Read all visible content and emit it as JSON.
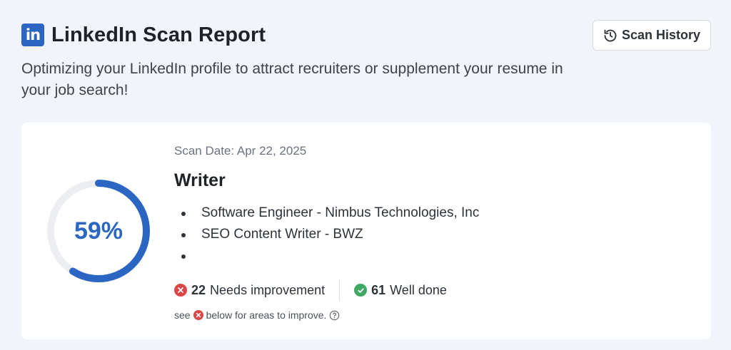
{
  "header": {
    "logo_text": "in",
    "title": "LinkedIn Scan Report",
    "subtitle": "Optimizing your LinkedIn profile to attract recruiters or supplement your resume in your job search!",
    "history_button": "Scan History"
  },
  "report": {
    "score": "59%",
    "score_value": 59,
    "scan_date": "Scan Date: Apr 22, 2025",
    "job_title": "Writer",
    "experiences": [
      "Software Engineer - Nimbus Technologies, Inc",
      "SEO Content Writer - BWZ",
      ""
    ],
    "needs_count": "22",
    "needs_label": "Needs improvement",
    "done_count": "61",
    "done_label": "Well done",
    "hint_prefix": "see",
    "hint_suffix": "below for areas to improve."
  },
  "colors": {
    "accent": "#2c66c3",
    "error": "#dc4646",
    "success": "#3fa862",
    "track": "#eceef1"
  },
  "icons": {
    "logo": "linkedin-logo",
    "history": "history-clock-icon",
    "needs": "x-circle-icon",
    "done": "check-circle-icon",
    "help": "question-circle-icon"
  }
}
